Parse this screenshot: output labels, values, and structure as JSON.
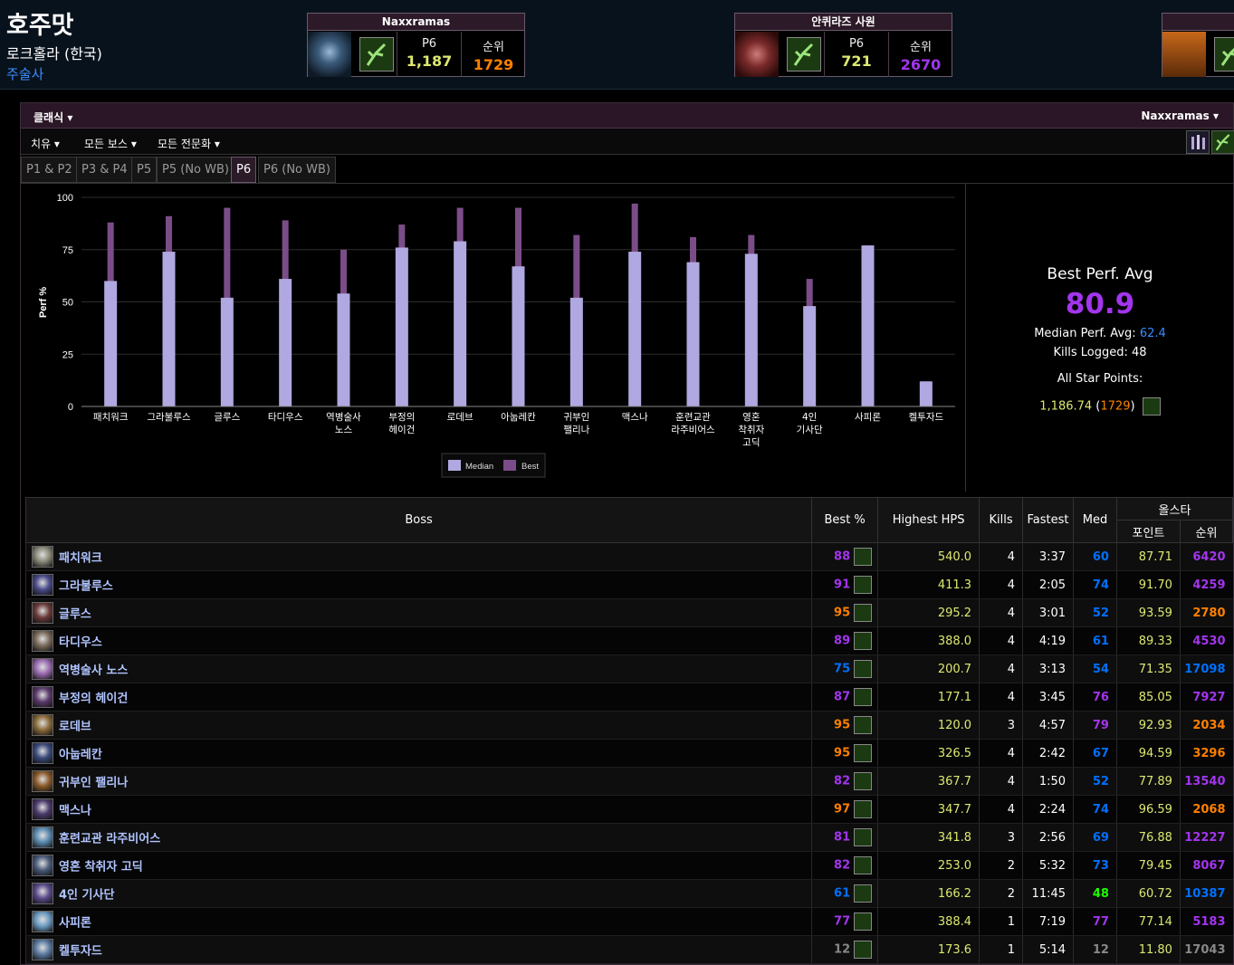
{
  "character": {
    "name": "호주맛",
    "server": "로크홀라 (한국)",
    "class": "주술사"
  },
  "zone_cards": [
    {
      "title": "Naxxramas",
      "phase_label": "P6",
      "score": "1,187",
      "rank_label": "순위",
      "rank": "1729",
      "rank_color": "#ff8000",
      "img_color": "#3a5a7a"
    },
    {
      "title": "안퀴라즈 사원",
      "phase_label": "P6",
      "score": "721",
      "rank_label": "순위",
      "rank": "2670",
      "rank_color": "#a335ee",
      "img_color": "#7a2a2a"
    }
  ],
  "toolbar": {
    "mode": "클래식",
    "zone": "Naxxramas",
    "metric": "치유",
    "bosses": "모든 보스",
    "spec": "모든 전문화"
  },
  "tabs": [
    "P1 & P2",
    "P3 & P4",
    "P5",
    "P5 (No WB)",
    "P6",
    "P6 (No WB)"
  ],
  "active_tab": 4,
  "chart_data": {
    "type": "bar",
    "ylabel": "Perf %",
    "ylim": [
      0,
      100
    ],
    "yticks": [
      0,
      25,
      50,
      75,
      100
    ],
    "categories": [
      "패치워크",
      "그라불루스",
      "글루스",
      "타디우스",
      "역병술사 노스",
      "부정의 헤이건",
      "로데브",
      "아눕레칸",
      "귀부인 팰리나",
      "맥스나",
      "훈련교관 라주비어스",
      "영혼 착취자 고딕",
      "4인 기사단",
      "사피론",
      "켈투자드"
    ],
    "category_lines": [
      [
        "패치워크"
      ],
      [
        "그라불루스"
      ],
      [
        "글루스"
      ],
      [
        "타디우스"
      ],
      [
        "역병술사",
        "노스"
      ],
      [
        "부정의",
        "헤이건"
      ],
      [
        "로데브"
      ],
      [
        "아눕레칸"
      ],
      [
        "귀부인",
        "팰리나"
      ],
      [
        "맥스나"
      ],
      [
        "훈련교관",
        "라주비어스"
      ],
      [
        "영혼",
        "착취자",
        "고딕"
      ],
      [
        "4인",
        "기사단"
      ],
      [
        "사피론"
      ],
      [
        "켈투자드"
      ]
    ],
    "series": [
      {
        "name": "Median",
        "color": "#b0a8e0",
        "values": [
          60,
          74,
          52,
          61,
          54,
          76,
          79,
          67,
          52,
          74,
          69,
          73,
          48,
          77,
          12
        ]
      },
      {
        "name": "Best",
        "color": "#7b4d88",
        "values": [
          88,
          91,
          95,
          89,
          75,
          87,
          95,
          95,
          82,
          97,
          81,
          82,
          61,
          77,
          12
        ]
      }
    ],
    "legend": "bottom",
    "grid": true
  },
  "summary": {
    "title": "Best Perf. Avg",
    "best_avg": "80.9",
    "median_label": "Median Perf. Avg:",
    "median_avg": "62.4",
    "kills_label": "Kills Logged:",
    "kills": "48",
    "allstar_label": "All Star Points:",
    "allstar_points": "1,186.74",
    "allstar_rank": "1729"
  },
  "table": {
    "headers": {
      "boss": "Boss",
      "best": "Best %",
      "hps": "Highest HPS",
      "kills": "Kills",
      "fastest": "Fastest",
      "med": "Med",
      "allstar": "올스타",
      "points": "포인트",
      "rank": "순위"
    },
    "rows": [
      {
        "name": "패치워크",
        "best": "88",
        "best_color": "#a335ee",
        "hps": "540.0",
        "kills": "4",
        "fastest": "3:37",
        "med": "60",
        "med_color": "#0070ff",
        "points": "87.71",
        "rank": "6420",
        "rank_color": "#a335ee",
        "icon": "#8a8a7a"
      },
      {
        "name": "그라불루스",
        "best": "91",
        "best_color": "#a335ee",
        "hps": "411.3",
        "kills": "4",
        "fastest": "2:05",
        "med": "74",
        "med_color": "#0070ff",
        "points": "91.70",
        "rank": "4259",
        "rank_color": "#a335ee",
        "icon": "#4a4a8a"
      },
      {
        "name": "글루스",
        "best": "95",
        "best_color": "#ff8000",
        "hps": "295.2",
        "kills": "4",
        "fastest": "3:01",
        "med": "52",
        "med_color": "#0070ff",
        "points": "93.59",
        "rank": "2780",
        "rank_color": "#ff8000",
        "icon": "#6a3a3a"
      },
      {
        "name": "타디우스",
        "best": "89",
        "best_color": "#a335ee",
        "hps": "388.0",
        "kills": "4",
        "fastest": "4:19",
        "med": "61",
        "med_color": "#0070ff",
        "points": "89.33",
        "rank": "4530",
        "rank_color": "#a335ee",
        "icon": "#7a6a5a"
      },
      {
        "name": "역병술사 노스",
        "best": "75",
        "best_color": "#0070ff",
        "hps": "200.7",
        "kills": "4",
        "fastest": "3:13",
        "med": "54",
        "med_color": "#0070ff",
        "points": "71.35",
        "rank": "17098",
        "rank_color": "#0070ff",
        "icon": "#9a6ab0"
      },
      {
        "name": "부정의 헤이건",
        "best": "87",
        "best_color": "#a335ee",
        "hps": "177.1",
        "kills": "4",
        "fastest": "3:45",
        "med": "76",
        "med_color": "#a335ee",
        "points": "85.05",
        "rank": "7927",
        "rank_color": "#a335ee",
        "icon": "#5a3a6a"
      },
      {
        "name": "로데브",
        "best": "95",
        "best_color": "#ff8000",
        "hps": "120.0",
        "kills": "3",
        "fastest": "4:57",
        "med": "79",
        "med_color": "#a335ee",
        "points": "92.93",
        "rank": "2034",
        "rank_color": "#ff8000",
        "icon": "#8a6a3a"
      },
      {
        "name": "아눕레칸",
        "best": "95",
        "best_color": "#ff8000",
        "hps": "326.5",
        "kills": "4",
        "fastest": "2:42",
        "med": "67",
        "med_color": "#0070ff",
        "points": "94.59",
        "rank": "3296",
        "rank_color": "#ff8000",
        "icon": "#3a4a7a"
      },
      {
        "name": "귀부인 팰리나",
        "best": "82",
        "best_color": "#a335ee",
        "hps": "367.7",
        "kills": "4",
        "fastest": "1:50",
        "med": "52",
        "med_color": "#0070ff",
        "points": "77.89",
        "rank": "13540",
        "rank_color": "#a335ee",
        "icon": "#8a5a2a"
      },
      {
        "name": "맥스나",
        "best": "97",
        "best_color": "#ff8000",
        "hps": "347.7",
        "kills": "4",
        "fastest": "2:24",
        "med": "74",
        "med_color": "#0070ff",
        "points": "96.59",
        "rank": "2068",
        "rank_color": "#ff8000",
        "icon": "#4a3a6a"
      },
      {
        "name": "훈련교관 라주비어스",
        "best": "81",
        "best_color": "#a335ee",
        "hps": "341.8",
        "kills": "3",
        "fastest": "2:56",
        "med": "69",
        "med_color": "#0070ff",
        "points": "76.88",
        "rank": "12227",
        "rank_color": "#a335ee",
        "icon": "#5a8ab0"
      },
      {
        "name": "영혼 착취자 고딕",
        "best": "82",
        "best_color": "#a335ee",
        "hps": "253.0",
        "kills": "2",
        "fastest": "5:32",
        "med": "73",
        "med_color": "#0070ff",
        "points": "79.45",
        "rank": "8067",
        "rank_color": "#a335ee",
        "icon": "#4a5a7a"
      },
      {
        "name": "4인 기사단",
        "best": "61",
        "best_color": "#0070ff",
        "hps": "166.2",
        "kills": "2",
        "fastest": "11:45",
        "med": "48",
        "med_color": "#1eff00",
        "points": "60.72",
        "rank": "10387",
        "rank_color": "#0070ff",
        "icon": "#5a4a8a"
      },
      {
        "name": "사피론",
        "best": "77",
        "best_color": "#a335ee",
        "hps": "388.4",
        "kills": "1",
        "fastest": "7:19",
        "med": "77",
        "med_color": "#a335ee",
        "points": "77.14",
        "rank": "5183",
        "rank_color": "#a335ee",
        "icon": "#6a9ac0"
      },
      {
        "name": "켈투자드",
        "best": "12",
        "best_color": "#888888",
        "hps": "173.6",
        "kills": "1",
        "fastest": "5:14",
        "med": "12",
        "med_color": "#888888",
        "points": "11.80",
        "rank": "17043",
        "rank_color": "#888888",
        "icon": "#5a7aa0"
      }
    ]
  },
  "colors": {
    "hps": "#dde870",
    "points": "#dde870",
    "score": "#dde870"
  }
}
